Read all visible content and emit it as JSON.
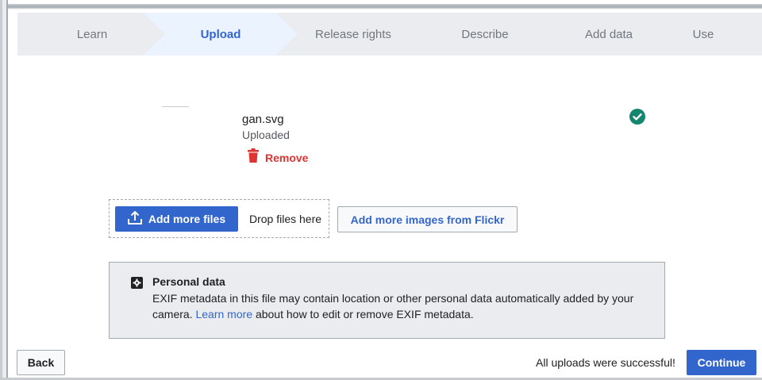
{
  "stepper": {
    "steps": [
      {
        "label": "Learn",
        "active": false
      },
      {
        "label": "Upload",
        "active": true
      },
      {
        "label": "Release rights",
        "active": false
      },
      {
        "label": "Describe",
        "active": false
      },
      {
        "label": "Add data",
        "active": false
      },
      {
        "label": "Use",
        "active": false
      }
    ]
  },
  "file": {
    "name": "gan.svg",
    "status": "Uploaded",
    "remove_label": "Remove"
  },
  "upload_actions": {
    "add_files_label": "Add more files",
    "drop_text": "Drop files here",
    "flickr_label": "Add more images from Flickr"
  },
  "notice": {
    "title": "Personal data",
    "text_before": "EXIF metadata in this file may contain location or other personal data automatically added by your camera. ",
    "link_text": "Learn more",
    "text_after": " about how to edit or remove EXIF metadata."
  },
  "footer": {
    "back_label": "Back",
    "success_text": "All uploads were successful!",
    "continue_label": "Continue"
  },
  "colors": {
    "accent": "#3366cc",
    "destructive": "#d33",
    "success": "#14866d",
    "step_inactive": "#eaecf0",
    "step_active": "#eaf3ff"
  },
  "icons": {
    "upload": "upload-icon",
    "trash": "trash-icon",
    "check": "check-circle-icon",
    "notice": "settings-icon"
  }
}
